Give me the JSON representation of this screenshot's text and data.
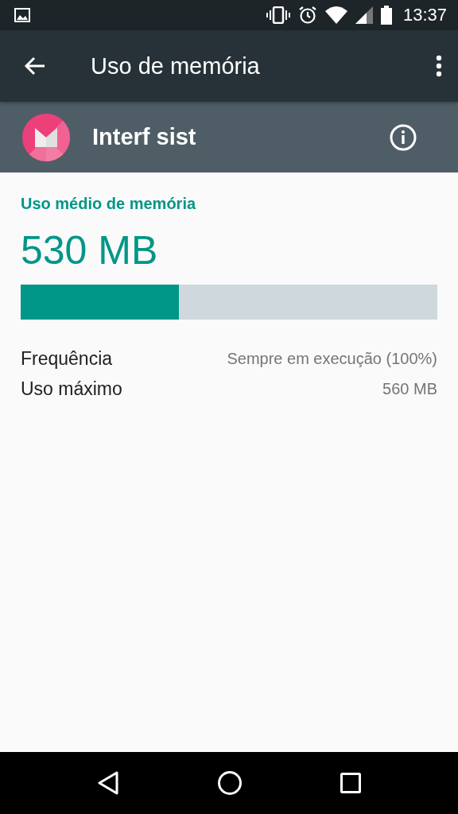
{
  "status_bar": {
    "time": "13:37"
  },
  "toolbar": {
    "title": "Uso de memória"
  },
  "app": {
    "name": "Interf sist"
  },
  "summary": {
    "heading": "Uso médio de memória",
    "value": "530 MB",
    "level": 0.38
  },
  "details": [
    {
      "label": "Frequência",
      "value": "Sempre em execução (100%)"
    },
    {
      "label": "Uso máximo",
      "value": "560 MB"
    }
  ]
}
